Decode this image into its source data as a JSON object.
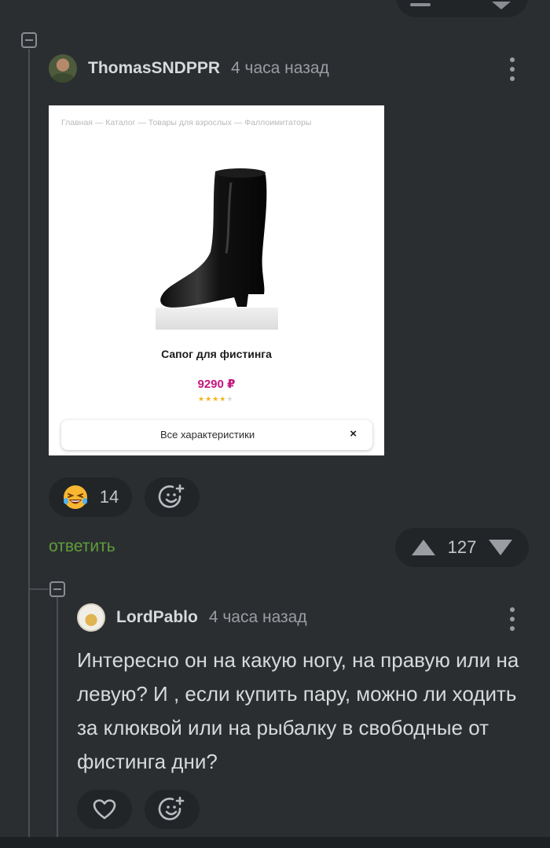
{
  "comment_main": {
    "username": "ThomasSNDPPR",
    "timestamp": "4 часа назад",
    "product": {
      "breadcrumb": "Главная — Каталог — Товары для взрослых — Фаллоимитаторы",
      "title": "Сапог для фистинга",
      "price": "9290 ₽",
      "rating_stars": 4,
      "rating_max": 5,
      "specs_button": "Все характеристики",
      "close_glyph": "×"
    },
    "reaction": {
      "icon": "laughing-emoji",
      "count": "14"
    },
    "add_reaction_icon": "add-emoji-icon",
    "reply_label": "ответить",
    "rating": "127"
  },
  "comment_reply": {
    "username": "LordPablo",
    "timestamp": "4 часа назад",
    "text": "Интересно он на какую ногу, на правую или на левую? И , если купить пару, можно ли ходить за клюквой или на рыбалку в свободные от фистинга дни?",
    "like_icon": "heart-icon",
    "add_reaction_icon": "add-emoji-icon"
  },
  "colors": {
    "background": "#2b2e31",
    "pill": "#222528",
    "reply_link": "#5f9d38",
    "price": "#c2187e"
  }
}
